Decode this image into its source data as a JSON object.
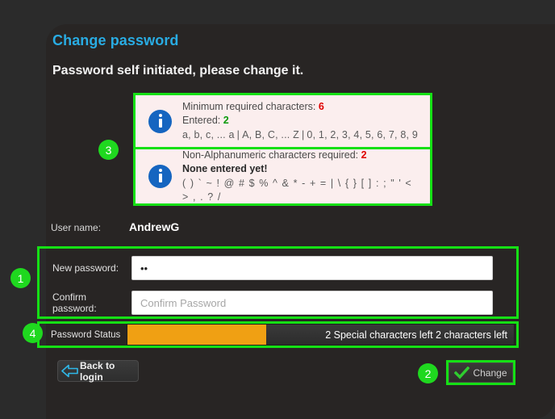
{
  "page": {
    "title": "Change password",
    "subtitle": "Password self initiated, please change it."
  },
  "info_panels": [
    {
      "icon": "info-icon",
      "line1_prefix": "Minimum required characters: ",
      "line1_value": "6",
      "line2_prefix": "Entered: ",
      "line2_value": "2",
      "line3_lower": "a, b, c, ... a",
      "line3_sep1": "|",
      "line3_upper": "A, B, C, ... Z",
      "line3_sep2": "|",
      "line3_digits": "0, 1, 2, 3, 4, 5, 6, 7, 8, 9"
    },
    {
      "icon": "info-icon",
      "line1_prefix": "Non-Alphanumeric characters required: ",
      "line1_value": "2",
      "line2": "None entered yet!",
      "line3": "( ) ` ~ ! @ # $ % ^ & * - + = | \\ { } [ ] : ; \" ' < > , . ? /"
    }
  ],
  "form": {
    "username_label": "User name:",
    "username_value": "AndrewG",
    "new_password_label": "New password:",
    "new_password_value": "••",
    "new_password_placeholder": "",
    "confirm_password_label": "Confirm password:",
    "confirm_password_value": "",
    "confirm_password_placeholder": "Confirm Password"
  },
  "status": {
    "label": "Password Status",
    "message": "2 Special characters left 2 characters left",
    "progress_percent": 36,
    "fill_color": "#f0a013"
  },
  "buttons": {
    "back": {
      "label": "Back to login",
      "icon": "left-arrow-icon"
    },
    "change": {
      "label": "Change",
      "icon": "checkmark-icon"
    }
  },
  "annotations": {
    "badge1": "1",
    "badge2": "2",
    "badge3": "3",
    "badge4": "4",
    "color": "#1fd81f"
  },
  "colors": {
    "page_background": "#2b2b2b",
    "card_background": "#282524",
    "title": "#29ace3",
    "highlight_green": "#15e015",
    "info_panel_bg": "#fbeeee",
    "required_red": "#e00000",
    "entered_green": "#0a9a0a",
    "info_icon_blue": "#1565c0"
  }
}
